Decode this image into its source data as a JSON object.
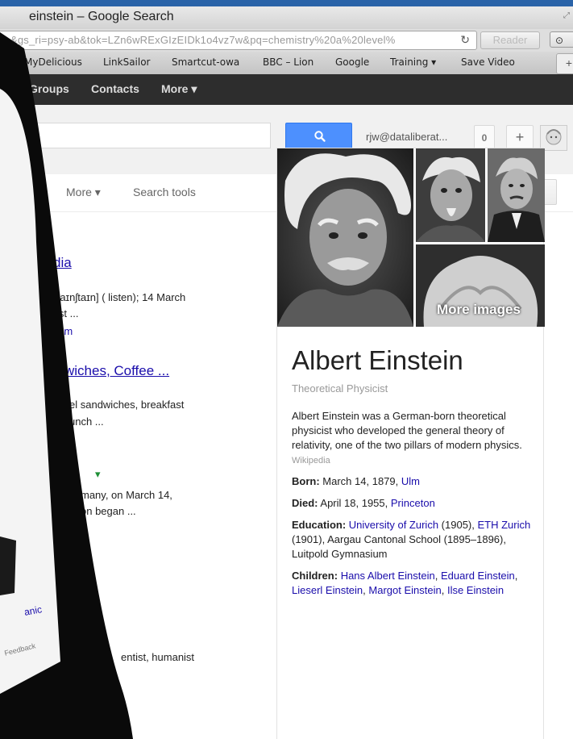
{
  "browser": {
    "window_title": "einstein – Google Search",
    "url": "&gs_ri=psy-ab&tok=LZn6wRExGIzEIDk1o4vz7w&pq=chemistry%20a%20level%",
    "reader_label": "Reader",
    "bookmarks": [
      "MyDelicious",
      "LinkSailor",
      "Smartcut-owa",
      "BBC – Lion",
      "Google",
      "Training ▾",
      "Save Video"
    ]
  },
  "gbar": {
    "items": [
      "Groups",
      "Contacts",
      "More ▾"
    ]
  },
  "header": {
    "user_email": "rjw@dataliberat...",
    "notification_count": "0",
    "share_label": "+"
  },
  "tools": {
    "more_label": "More ▾",
    "search_tools_label": "Search tools"
  },
  "results": {
    "r1_title": "dia",
    "r1_snippet_1": "ˈaɪnʃtaɪn] ( listen); 14 March",
    "r1_snippet_2": "ist ...",
    "r1_sublink": "ism",
    "r2_title": "wiches, Coffee ...",
    "r2_snippet_1": "el sandwiches, breakfast",
    "r2_snippet_2": "unch ...",
    "r3_green": "▾",
    "r3_snippet_1": "many, on March 14,",
    "r3_snippet_2": "on began ...",
    "r4_snippet": "entist, humanist"
  },
  "knowledge_panel": {
    "name": "Albert Einstein",
    "subtitle": "Theoretical Physicist",
    "description": "Albert Einstein was a German-born theoretical physicist who developed the general theory of relativity, one of the two pillars of modern physics.",
    "source": "Wikipedia",
    "more_images": "More images",
    "born_label": "Born:",
    "born_value": "March 14, 1879,",
    "born_place": "Ulm",
    "died_label": "Died:",
    "died_value": "April 18, 1955,",
    "died_place": "Princeton",
    "education_label": "Education:",
    "education_1": "University of Zurich",
    "education_1_year": "(1905),",
    "education_2": "ETH Zurich",
    "education_2_rest": "(1901), Aargau Cantonal School (1895–1896), Luitpold Gymnasium",
    "children_label": "Children:",
    "children_1": "Hans Albert Einstein",
    "children_2": "Eduard Einstein",
    "children_3": "Lieserl Einstein",
    "children_4": "Margot Einstein",
    "children_5": "Ilse Einstein"
  },
  "tablet": {
    "link_text": "anic",
    "feedback": "Feedback"
  }
}
